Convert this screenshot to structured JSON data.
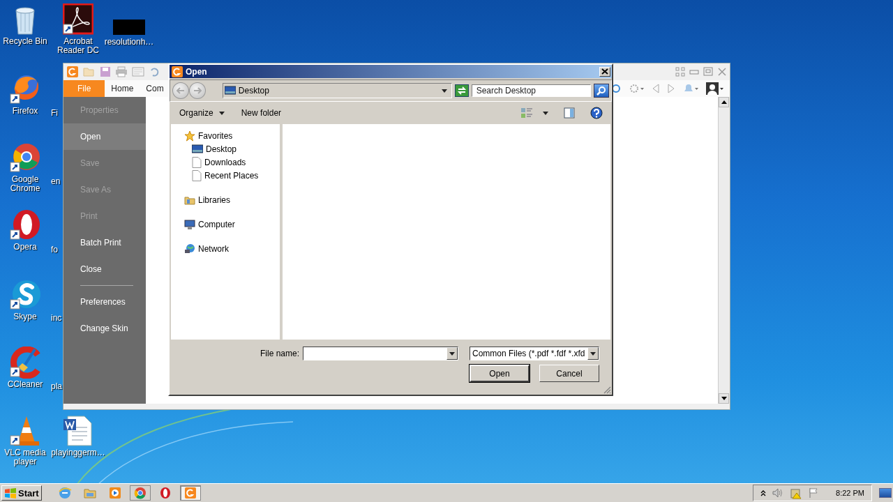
{
  "desktop_icons": [
    {
      "label": "Recycle Bin"
    },
    {
      "label": "Firefox"
    },
    {
      "label": "Google Chrome"
    },
    {
      "label": "Opera"
    },
    {
      "label": "Skype"
    },
    {
      "label": "CCleaner"
    },
    {
      "label": "VLC media player"
    },
    {
      "label": "Acrobat Reader DC"
    },
    {
      "label": "resolutionh…"
    },
    {
      "label": "playinggerm…"
    }
  ],
  "covered_icon_labels": [
    "Fi",
    "en",
    "fo",
    "inc",
    "pla"
  ],
  "app_window": {
    "tabs": [
      {
        "label": "File",
        "selected": true
      },
      {
        "label": "Home",
        "selected": false
      },
      {
        "label": "Com",
        "selected": false
      }
    ],
    "file_menu": [
      [
        {
          "label": "Properties",
          "disabled": true,
          "selected": false
        },
        {
          "label": "Open",
          "disabled": false,
          "selected": true
        },
        {
          "label": "Save",
          "disabled": true,
          "selected": false
        },
        {
          "label": "Save As",
          "disabled": true,
          "selected": false
        },
        {
          "label": "Print",
          "disabled": true,
          "selected": false
        },
        {
          "label": "Batch Print",
          "disabled": false,
          "selected": false
        },
        {
          "label": "Close",
          "disabled": false,
          "selected": false
        }
      ],
      [
        {
          "label": "Preferences",
          "disabled": false,
          "selected": false
        },
        {
          "label": "Change Skin",
          "disabled": false,
          "selected": false
        }
      ]
    ]
  },
  "dialog": {
    "title": "Open",
    "address": "Desktop",
    "search": {
      "placeholder": "Search Desktop"
    },
    "toolbar": [
      "Organize",
      "New folder"
    ],
    "nav": [
      {
        "label": "Favorites",
        "children": [
          {
            "label": "Desktop"
          },
          {
            "label": "Downloads"
          },
          {
            "label": "Recent Places"
          }
        ]
      },
      {
        "label": "Libraries"
      },
      {
        "label": "Computer"
      },
      {
        "label": "Network"
      }
    ],
    "file_name_label": "File name:",
    "file_type": "Common Files (*.pdf *.fdf *.xfd",
    "buttons": [
      "Open",
      "Cancel"
    ]
  },
  "taskbar": {
    "start": "Start",
    "apps": [
      {
        "running": false,
        "selected": false
      },
      {
        "running": false,
        "selected": false
      },
      {
        "running": false,
        "selected": false
      },
      {
        "running": true,
        "selected": false
      },
      {
        "running": false,
        "selected": false
      },
      {
        "running": true,
        "selected": true
      }
    ],
    "clock": "8:22 PM"
  }
}
